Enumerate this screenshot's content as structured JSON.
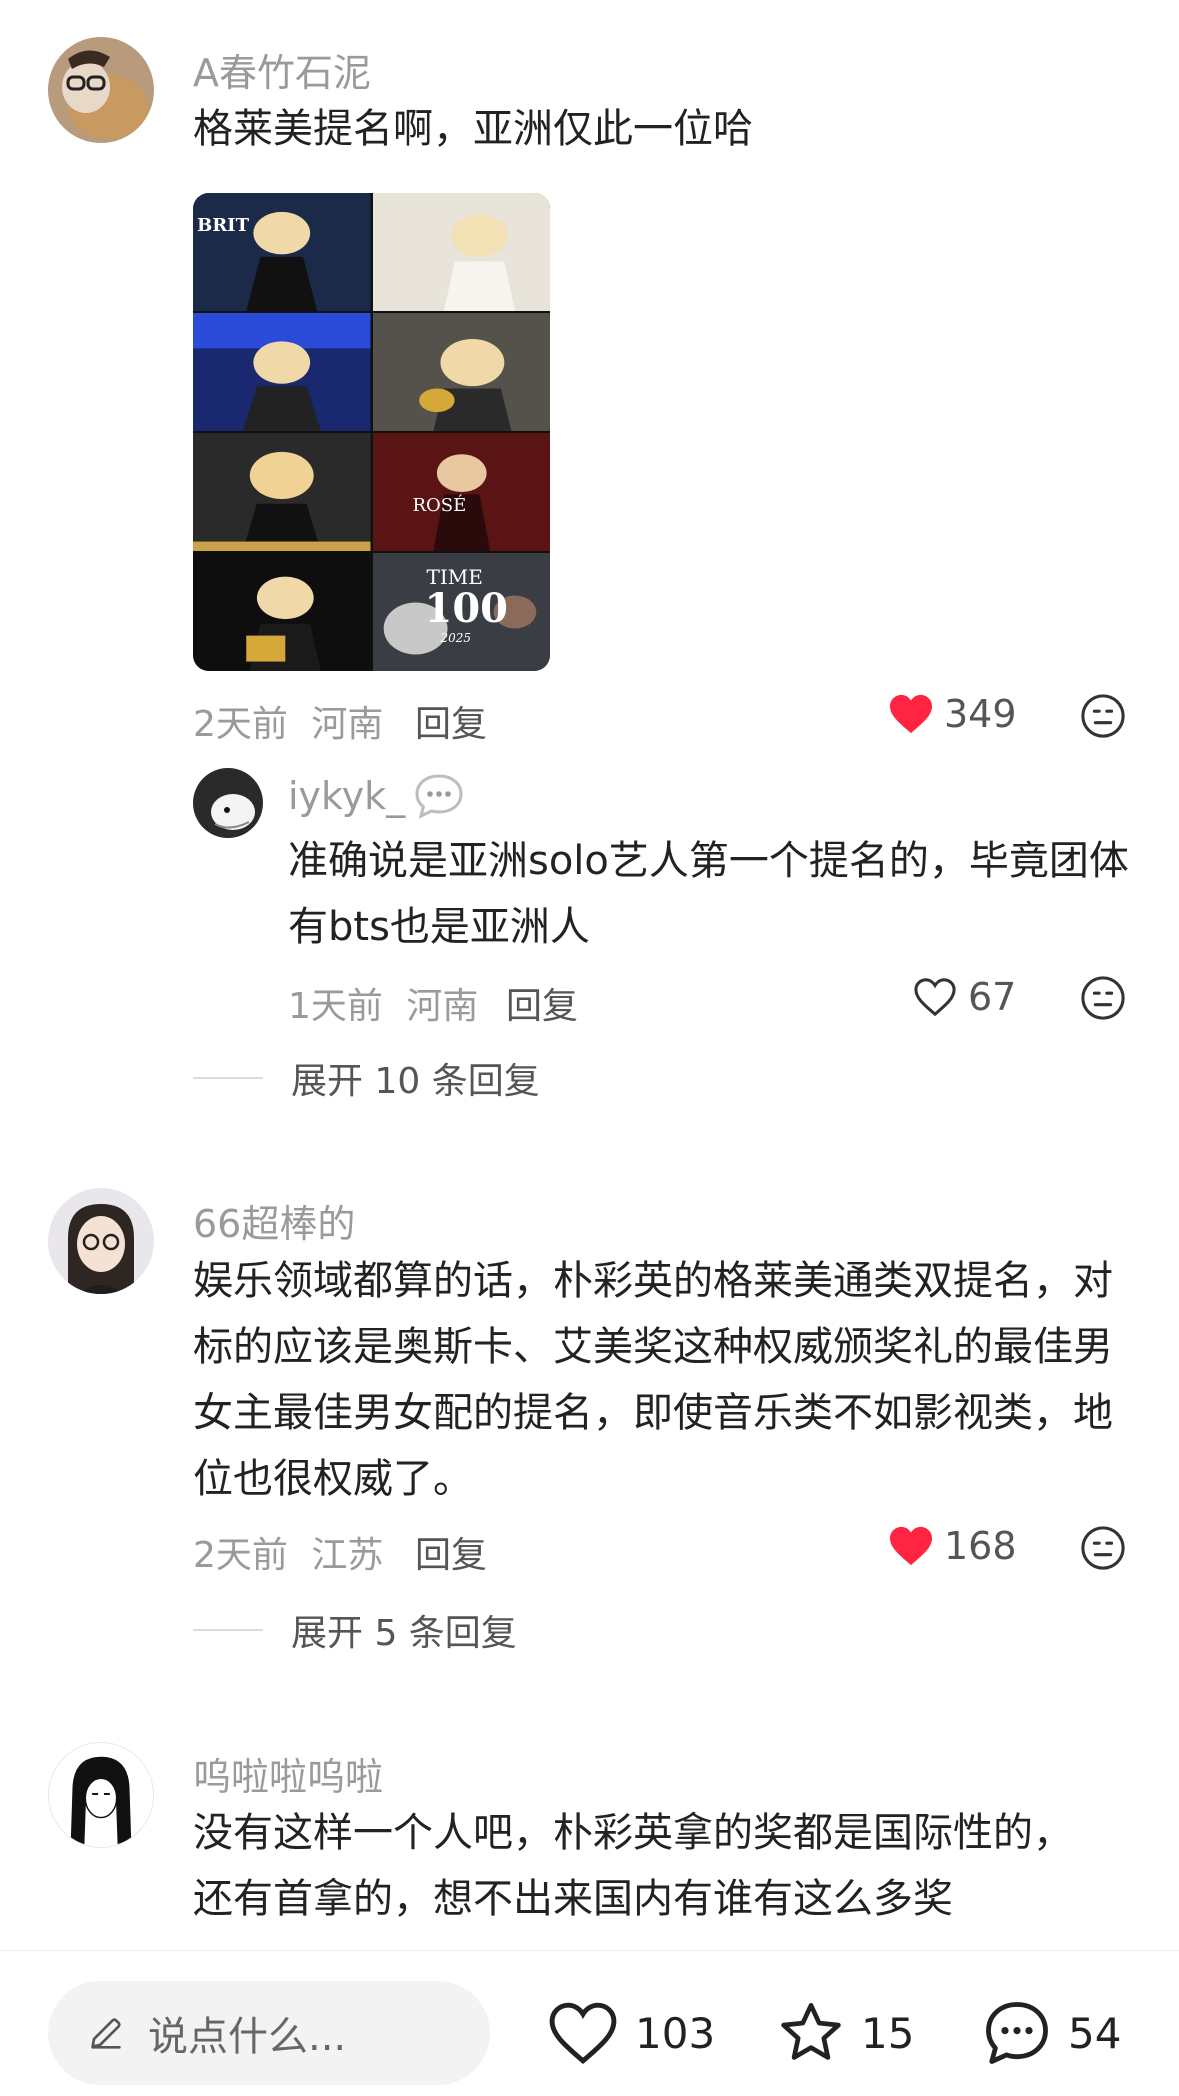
{
  "comments": [
    {
      "username": "A春竹石泥",
      "text": "格莱美提名啊，亚洲仅此一位哈",
      "time": "2天前",
      "location": "河南",
      "reply_label": "回复",
      "likes": "349",
      "liked": true,
      "image_texts": {
        "brit": "BRIT",
        "rose": "ROSÉ",
        "time": "TIME",
        "hundred": "100",
        "year": "2025"
      },
      "replies": [
        {
          "username": "iykyk_",
          "text": "准确说是亚洲solo艺人第一个提名的，毕竟团体有bts也是亚洲人",
          "time": "1天前",
          "location": "河南",
          "reply_label": "回复",
          "likes": "67",
          "liked": false
        }
      ],
      "expand_label": "展开 10 条回复"
    },
    {
      "username": "66超棒的",
      "text": "娱乐领域都算的话，朴彩英的格莱美通类双提名，对标的应该是奥斯卡、艾美奖这种权威颁奖礼的最佳男女主最佳男女配的提名，即使音乐类不如影视类，地位也很权威了。",
      "time": "2天前",
      "location": "江苏",
      "reply_label": "回复",
      "likes": "168",
      "liked": true,
      "expand_label": "展开 5 条回复"
    },
    {
      "username": "呜啦啦呜啦",
      "text": "没有这样一个人吧，朴彩英拿的奖都是国际性的，还有首拿的，想不出来国内有谁有这么多奖"
    }
  ],
  "bottom_bar": {
    "input_placeholder": "说点什么...",
    "likes": "103",
    "favorites": "15",
    "comments": "54"
  },
  "colors": {
    "like_red": "#ff2442",
    "text_gray": "#9a9a9a"
  }
}
